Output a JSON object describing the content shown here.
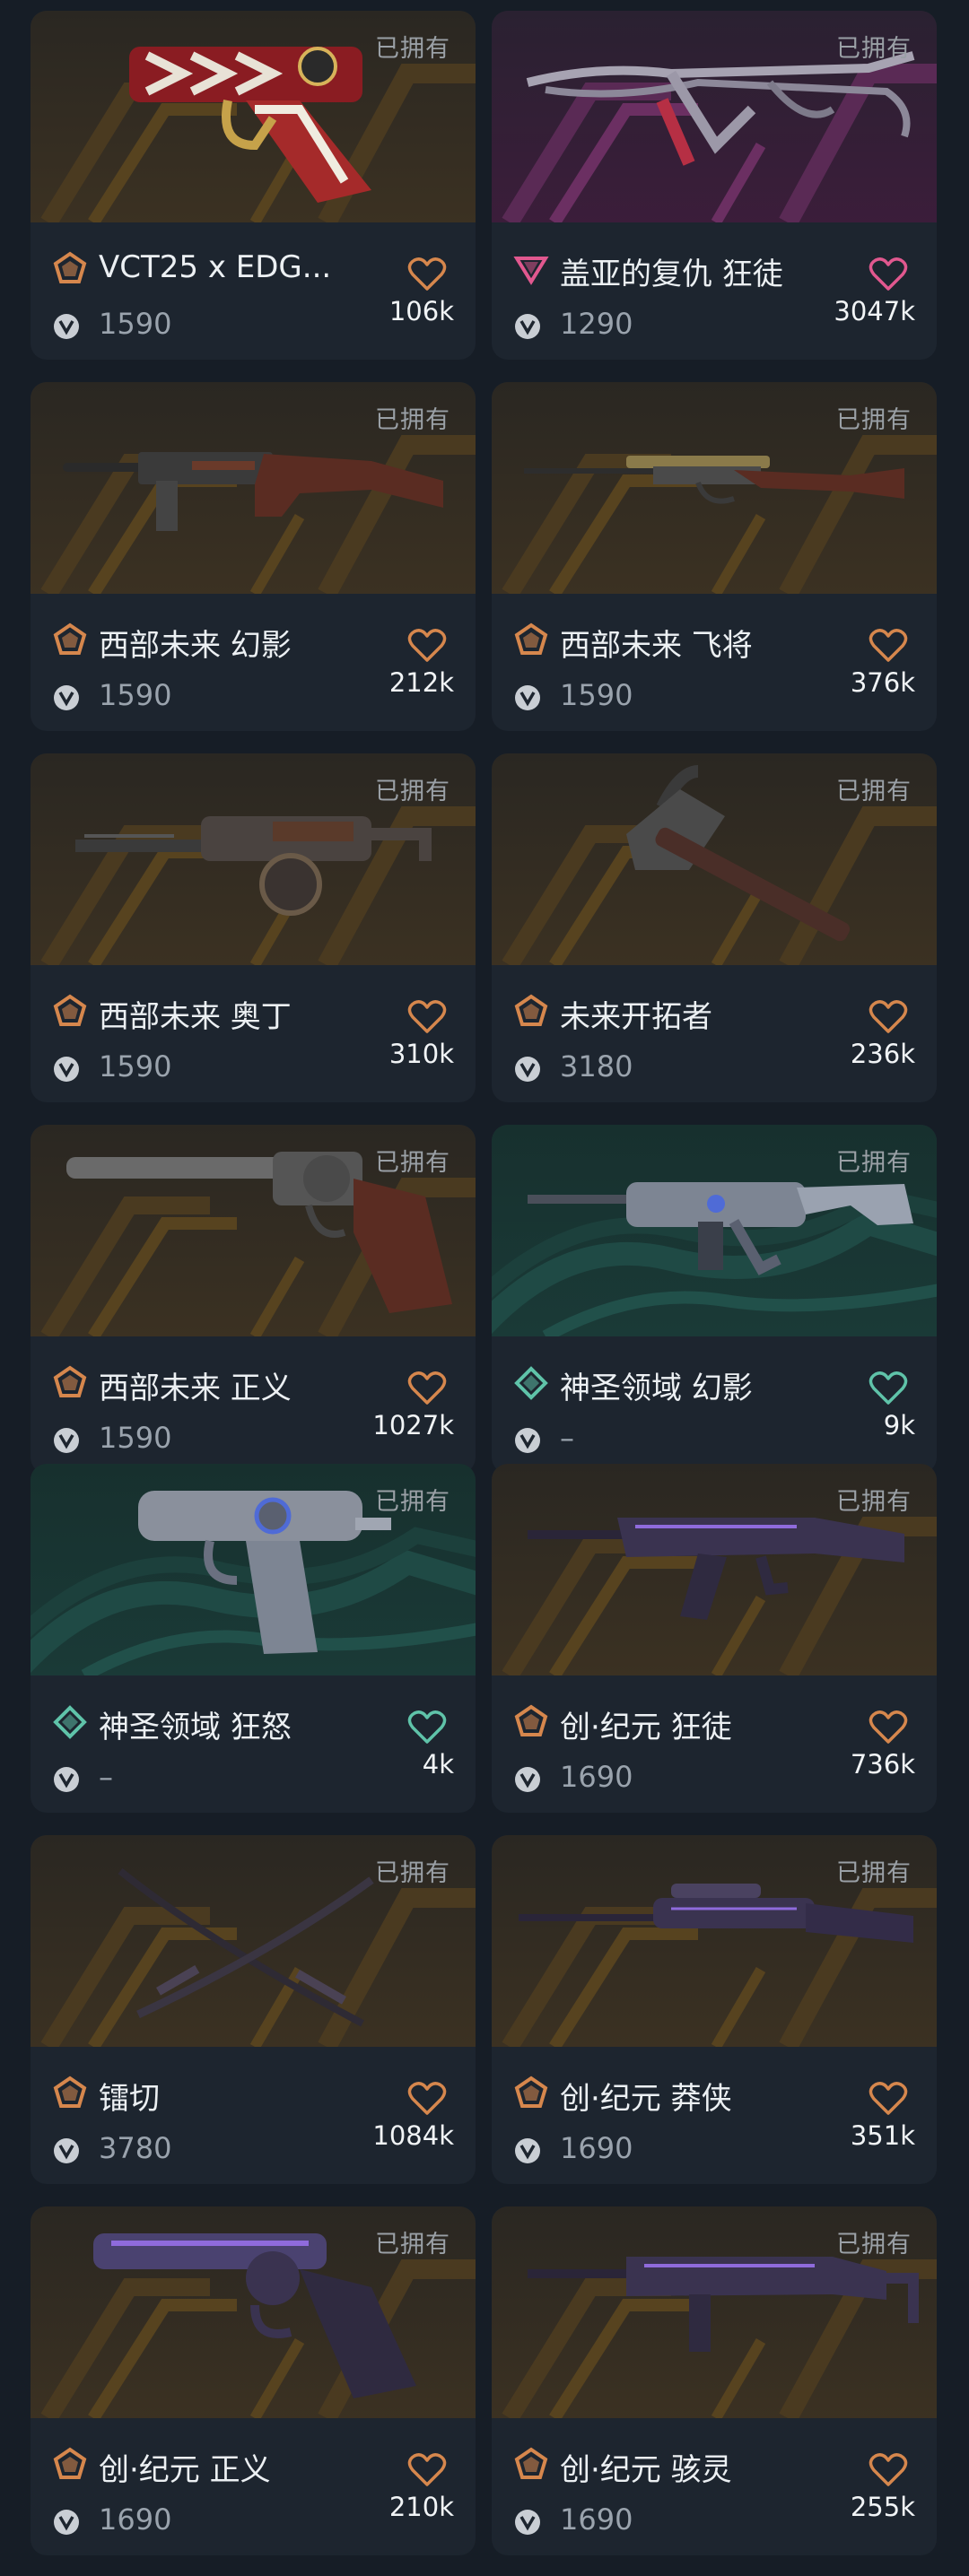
{
  "colors": {
    "premium": "#d6874d",
    "exclusive": "#e1588f",
    "select": "#5fc3a9",
    "text_muted": "#9aa3ad"
  },
  "owned_label": "已拥有",
  "skins": [
    {
      "name": "VCT25 x EDG...",
      "price": "1590",
      "likes": "106k",
      "tier": "premium-tier-icon",
      "heart_color": "#d6874d",
      "bg": "bg-gold",
      "weapon": "pistol-edg"
    },
    {
      "name": "盖亚的复仇 狂徒",
      "price": "1290",
      "likes": "3047k",
      "tier": "exclusive-tier-icon",
      "heart_color": "#e1588f",
      "bg": "bg-purple",
      "weapon": "rifle-vine"
    },
    {
      "name": "西部未来 幻影",
      "price": "1590",
      "likes": "212k",
      "tier": "premium-tier-icon",
      "heart_color": "#d6874d",
      "bg": "bg-gold",
      "weapon": "rifle-wood"
    },
    {
      "name": "西部未来 飞将",
      "price": "1590",
      "likes": "376k",
      "tier": "premium-tier-icon",
      "heart_color": "#d6874d",
      "bg": "bg-gold",
      "weapon": "sniper-wood"
    },
    {
      "name": "西部未来 奥丁",
      "price": "1590",
      "likes": "310k",
      "tier": "premium-tier-icon",
      "heart_color": "#d6874d",
      "bg": "bg-gold",
      "weapon": "mg-drum"
    },
    {
      "name": "未来开拓者",
      "price": "3180",
      "likes": "236k",
      "tier": "premium-tier-icon",
      "heart_color": "#d6874d",
      "bg": "bg-gold",
      "weapon": "pickaxe"
    },
    {
      "name": "西部未来 正义",
      "price": "1590",
      "likes": "1027k",
      "tier": "premium-tier-icon",
      "heart_color": "#d6874d",
      "bg": "bg-gold",
      "weapon": "revolver-wood"
    },
    {
      "name": "神圣领域 幻影",
      "price": "–",
      "likes": "9k",
      "tier": "select-tier-icon",
      "heart_color": "#5fc3a9",
      "bg": "bg-teal",
      "weapon": "rifle-silver"
    },
    {
      "name": "神圣领域 狂怒",
      "price": "–",
      "likes": "4k",
      "tier": "select-tier-icon",
      "heart_color": "#5fc3a9",
      "bg": "bg-teal",
      "weapon": "pistol-silver"
    },
    {
      "name": "创·纪元 狂徒",
      "price": "1690",
      "likes": "736k",
      "tier": "premium-tier-icon",
      "heart_color": "#d6874d",
      "bg": "bg-gold",
      "weapon": "rifle-purple"
    },
    {
      "name": "镭切",
      "price": "3780",
      "likes": "1084k",
      "tier": "premium-tier-icon",
      "heart_color": "#d6874d",
      "bg": "bg-gold",
      "weapon": "swords"
    },
    {
      "name": "创·纪元 莽侠",
      "price": "1690",
      "likes": "351k",
      "tier": "premium-tier-icon",
      "heart_color": "#d6874d",
      "bg": "bg-gold",
      "weapon": "sniper-purple"
    },
    {
      "name": "创·纪元 正义",
      "price": "1690",
      "likes": "210k",
      "tier": "premium-tier-icon",
      "heart_color": "#d6874d",
      "bg": "bg-gold",
      "weapon": "revolver-purple"
    },
    {
      "name": "创·纪元 骇灵",
      "price": "1690",
      "likes": "255k",
      "tier": "premium-tier-icon",
      "heart_color": "#d6874d",
      "bg": "bg-gold",
      "weapon": "smg-purple"
    }
  ]
}
